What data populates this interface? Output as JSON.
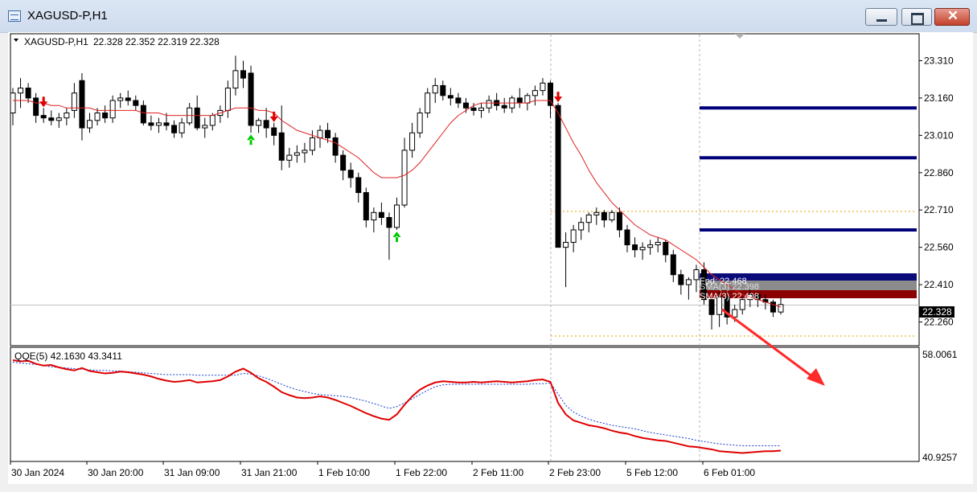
{
  "window": {
    "title": "XAGUSD-P,H1",
    "icons": [
      "chart-window-icon",
      "minimize-icon",
      "restore-icon",
      "close-icon"
    ]
  },
  "main_chart": {
    "symbol_label": "XAGUSD-P,H1",
    "ohlc": "22.328 22.352 22.319 22.328",
    "current_price": "22.328",
    "price_ticks": [
      "23.310",
      "23.160",
      "23.010",
      "22.860",
      "22.710",
      "22.560",
      "22.410",
      "22.260"
    ],
    "bar_labels": [
      "Fpd: 22.468",
      "SMA(3) 22.398",
      "SMA(3) 22.408"
    ],
    "colors": {
      "bull": "#ffffff",
      "bear": "#000000",
      "ma": "#e02020",
      "level_line": "#00007a",
      "arrow_up": "#00cc00",
      "arrow_down": "#e00000"
    }
  },
  "indicator": {
    "label": "QQE(5) 42.1630 43.3411",
    "max_label": "58.0061",
    "min_label": "40.9257"
  },
  "time_axis": {
    "labels": [
      "30 Jan 2024",
      "30 Jan 20:00",
      "31 Jan 09:00",
      "31 Jan 21:00",
      "1 Feb 10:00",
      "1 Feb 22:00",
      "2 Feb 11:00",
      "2 Feb 23:00",
      "5 Feb 12:00",
      "6 Feb 01:00"
    ]
  },
  "chart_data": {
    "type": "candlestick",
    "price_range": [
      22.21,
      23.36
    ],
    "candles": [
      [
        23.1,
        23.2,
        23.05,
        23.18
      ],
      [
        23.18,
        23.24,
        23.12,
        23.2
      ],
      [
        23.2,
        23.22,
        23.14,
        23.16
      ],
      [
        23.16,
        23.18,
        23.06,
        23.09
      ],
      [
        23.09,
        23.12,
        23.06,
        23.08
      ],
      [
        23.08,
        23.11,
        23.05,
        23.07
      ],
      [
        23.07,
        23.1,
        23.04,
        23.08
      ],
      [
        23.08,
        23.12,
        23.05,
        23.1
      ],
      [
        23.11,
        23.22,
        23.08,
        23.18
      ],
      [
        23.23,
        23.26,
        22.99,
        23.04
      ],
      [
        23.04,
        23.1,
        23.02,
        23.07
      ],
      [
        23.07,
        23.12,
        23.05,
        23.1
      ],
      [
        23.1,
        23.13,
        23.06,
        23.08
      ],
      [
        23.08,
        23.17,
        23.06,
        23.15
      ],
      [
        23.15,
        23.18,
        23.12,
        23.16
      ],
      [
        23.16,
        23.19,
        23.13,
        23.15
      ],
      [
        23.15,
        23.17,
        23.11,
        23.13
      ],
      [
        23.13,
        23.15,
        23.05,
        23.06
      ],
      [
        23.06,
        23.09,
        23.03,
        23.05
      ],
      [
        23.05,
        23.08,
        23.02,
        23.06
      ],
      [
        23.06,
        23.1,
        23.03,
        23.05
      ],
      [
        23.05,
        23.07,
        23.0,
        23.02
      ],
      [
        23.02,
        23.08,
        23.0,
        23.06
      ],
      [
        23.06,
        23.14,
        23.05,
        23.12
      ],
      [
        23.12,
        23.17,
        23.03,
        23.04
      ],
      [
        23.04,
        23.08,
        23.0,
        23.05
      ],
      [
        23.05,
        23.1,
        23.03,
        23.09
      ],
      [
        23.09,
        23.13,
        23.06,
        23.11
      ],
      [
        23.11,
        23.23,
        23.08,
        23.2
      ],
      [
        23.2,
        23.33,
        23.17,
        23.27
      ],
      [
        23.27,
        23.31,
        23.2,
        23.24
      ],
      [
        23.26,
        23.29,
        23.02,
        23.05
      ],
      [
        23.05,
        23.08,
        23.02,
        23.07
      ],
      [
        23.07,
        23.12,
        23.0,
        23.04
      ],
      [
        23.04,
        23.06,
        22.97,
        23.01
      ],
      [
        23.02,
        23.13,
        22.87,
        22.91
      ],
      [
        22.91,
        22.96,
        22.88,
        22.93
      ],
      [
        22.93,
        22.97,
        22.9,
        22.94
      ],
      [
        22.94,
        22.98,
        22.9,
        22.95
      ],
      [
        22.95,
        23.03,
        22.93,
        23.0
      ],
      [
        23.0,
        23.05,
        22.96,
        23.03
      ],
      [
        23.03,
        23.06,
        22.98,
        23.0
      ],
      [
        23.0,
        23.02,
        22.9,
        22.93
      ],
      [
        22.93,
        22.95,
        22.83,
        22.87
      ],
      [
        22.87,
        22.9,
        22.8,
        22.84
      ],
      [
        22.84,
        22.86,
        22.74,
        22.78
      ],
      [
        22.78,
        22.8,
        22.64,
        22.67
      ],
      [
        22.67,
        22.72,
        22.62,
        22.7
      ],
      [
        22.7,
        22.74,
        22.65,
        22.68
      ],
      [
        22.68,
        22.7,
        22.51,
        22.64
      ],
      [
        22.64,
        22.76,
        22.63,
        22.73
      ],
      [
        22.73,
        23.0,
        22.72,
        22.95
      ],
      [
        22.95,
        23.06,
        22.92,
        23.02
      ],
      [
        23.02,
        23.12,
        23.0,
        23.1
      ],
      [
        23.1,
        23.2,
        23.08,
        23.18
      ],
      [
        23.18,
        23.24,
        23.14,
        23.21
      ],
      [
        23.21,
        23.23,
        23.15,
        23.17
      ],
      [
        23.17,
        23.2,
        23.13,
        23.16
      ],
      [
        23.16,
        23.18,
        23.12,
        23.14
      ],
      [
        23.14,
        23.16,
        23.1,
        23.12
      ],
      [
        23.12,
        23.14,
        23.09,
        23.11
      ],
      [
        23.11,
        23.14,
        23.08,
        23.12
      ],
      [
        23.12,
        23.17,
        23.1,
        23.15
      ],
      [
        23.15,
        23.18,
        23.11,
        23.13
      ],
      [
        23.13,
        23.16,
        23.1,
        23.12
      ],
      [
        23.12,
        23.17,
        23.1,
        23.16
      ],
      [
        23.16,
        23.2,
        23.12,
        23.14
      ],
      [
        23.14,
        23.18,
        23.11,
        23.17
      ],
      [
        23.17,
        23.21,
        23.13,
        23.19
      ],
      [
        23.19,
        23.24,
        23.17,
        23.22
      ],
      [
        23.22,
        23.23,
        23.08,
        23.13
      ],
      [
        23.13,
        23.14,
        22.56,
        22.56
      ],
      [
        22.56,
        22.62,
        22.4,
        22.58
      ],
      [
        22.58,
        22.65,
        22.54,
        22.63
      ],
      [
        22.63,
        22.68,
        22.59,
        22.66
      ],
      [
        22.66,
        22.7,
        22.62,
        22.69
      ],
      [
        22.69,
        22.72,
        22.65,
        22.7
      ],
      [
        22.7,
        22.71,
        22.64,
        22.67
      ],
      [
        22.67,
        22.71,
        22.66,
        22.7
      ],
      [
        22.7,
        22.72,
        22.6,
        22.63
      ],
      [
        22.63,
        22.65,
        22.54,
        22.57
      ],
      [
        22.57,
        22.6,
        22.52,
        22.55
      ],
      [
        22.55,
        22.58,
        22.51,
        22.56
      ],
      [
        22.56,
        22.59,
        22.53,
        22.57
      ],
      [
        22.57,
        22.6,
        22.54,
        22.58
      ],
      [
        22.58,
        22.59,
        22.5,
        22.53
      ],
      [
        22.53,
        22.55,
        22.42,
        22.45
      ],
      [
        22.45,
        22.47,
        22.37,
        22.41
      ],
      [
        22.41,
        22.44,
        22.35,
        22.43
      ],
      [
        22.43,
        22.49,
        22.38,
        22.47
      ],
      [
        22.47,
        22.5,
        22.33,
        22.35
      ],
      [
        22.35,
        22.36,
        22.23,
        22.29
      ],
      [
        22.29,
        22.38,
        22.24,
        22.36
      ],
      [
        22.36,
        22.38,
        22.25,
        22.28
      ],
      [
        22.28,
        22.33,
        22.26,
        22.31
      ],
      [
        22.31,
        22.36,
        22.29,
        22.35
      ],
      [
        22.35,
        22.39,
        22.32,
        22.37
      ],
      [
        22.37,
        22.38,
        22.32,
        22.35
      ],
      [
        22.35,
        22.37,
        22.31,
        22.34
      ],
      [
        22.34,
        22.35,
        22.28,
        22.3
      ],
      [
        22.3,
        22.36,
        22.29,
        22.33
      ]
    ],
    "moving_average": [
      23.15,
      23.15,
      23.15,
      23.14,
      23.14,
      23.13,
      23.13,
      23.12,
      23.12,
      23.12,
      23.12,
      23.11,
      23.11,
      23.11,
      23.11,
      23.11,
      23.11,
      23.1,
      23.1,
      23.1,
      23.09,
      23.09,
      23.09,
      23.09,
      23.09,
      23.09,
      23.09,
      23.1,
      23.11,
      23.12,
      23.12,
      23.12,
      23.11,
      23.11,
      23.1,
      23.07,
      23.05,
      23.03,
      23.02,
      23.01,
      23.0,
      22.99,
      22.98,
      22.96,
      22.94,
      22.92,
      22.89,
      22.86,
      22.84,
      22.84,
      22.84,
      22.85,
      22.87,
      22.9,
      22.94,
      22.98,
      23.02,
      23.06,
      23.09,
      23.11,
      23.13,
      23.14,
      23.14,
      23.14,
      23.14,
      23.14,
      23.14,
      23.14,
      23.15,
      23.15,
      23.15,
      23.1,
      23.04,
      22.98,
      22.93,
      22.87,
      22.82,
      22.78,
      22.74,
      22.71,
      22.68,
      22.65,
      22.63,
      22.61,
      22.6,
      22.59,
      22.57,
      22.55,
      22.53,
      22.51,
      22.48,
      22.45,
      22.43,
      22.41,
      22.39,
      22.37,
      22.36,
      22.35,
      22.34,
      22.33,
      22.32
    ],
    "horizontal_levels": [
      23.12,
      22.92,
      22.63,
      22.468,
      22.42
    ],
    "signals": [
      {
        "index": 4,
        "dir": "down"
      },
      {
        "index": 31,
        "dir": "up"
      },
      {
        "index": 34,
        "dir": "down"
      },
      {
        "index": 50,
        "dir": "up"
      },
      {
        "index": 71,
        "dir": "down"
      }
    ],
    "qqe_range": [
      40.9257,
      58.0061
    ],
    "qqe_fast": [
      57.2,
      57.0,
      57.1,
      56.6,
      56.3,
      56.4,
      56.0,
      55.7,
      55.5,
      55.9,
      55.4,
      55.2,
      55.0,
      55.1,
      55.3,
      55.2,
      55.0,
      54.8,
      54.5,
      54.1,
      53.8,
      53.6,
      53.7,
      53.9,
      53.5,
      53.6,
      53.7,
      53.9,
      54.5,
      55.3,
      55.8,
      55.1,
      54.2,
      53.6,
      52.8,
      51.9,
      51.4,
      51.0,
      50.9,
      51.0,
      51.2,
      51.0,
      50.6,
      50.1,
      49.6,
      49.0,
      48.4,
      47.9,
      47.5,
      47.3,
      48.2,
      49.8,
      51.2,
      52.3,
      53.0,
      53.5,
      53.7,
      53.6,
      53.5,
      53.5,
      53.6,
      53.5,
      53.6,
      53.7,
      53.6,
      53.5,
      53.6,
      53.7,
      53.9,
      54.0,
      53.6,
      50.1,
      48.2,
      47.2,
      46.8,
      46.4,
      46.2,
      45.9,
      45.5,
      45.2,
      45.0,
      44.6,
      44.3,
      44.1,
      43.9,
      43.8,
      43.5,
      43.2,
      42.9,
      42.8,
      42.6,
      42.4,
      42.1,
      42.0,
      41.9,
      41.8,
      41.9,
      42.0,
      42.1,
      42.1,
      42.2
    ],
    "qqe_slow": [
      56.9,
      56.7,
      56.6,
      56.5,
      56.3,
      56.1,
      56.0,
      55.9,
      55.8,
      55.7,
      55.6,
      55.5,
      55.5,
      55.4,
      55.4,
      55.3,
      55.2,
      55.1,
      55.0,
      54.9,
      54.8,
      54.8,
      54.8,
      54.8,
      54.7,
      54.7,
      54.7,
      54.7,
      54.7,
      54.7,
      55.0,
      54.9,
      54.6,
      54.2,
      53.7,
      53.2,
      52.7,
      52.3,
      52.0,
      51.7,
      51.5,
      51.4,
      51.3,
      51.2,
      51.0,
      50.7,
      50.4,
      50.0,
      49.6,
      49.2,
      49.5,
      50.1,
      50.8,
      51.5,
      52.2,
      52.8,
      53.1,
      53.2,
      53.2,
      53.2,
      53.2,
      53.2,
      53.2,
      53.2,
      53.2,
      53.2,
      53.2,
      53.2,
      53.3,
      53.3,
      53.4,
      51.6,
      49.7,
      48.6,
      47.9,
      47.4,
      47.0,
      46.7,
      46.4,
      46.2,
      46.0,
      45.8,
      45.5,
      45.2,
      45.0,
      44.8,
      44.6,
      44.4,
      44.2,
      43.9,
      43.7,
      43.5,
      43.3,
      43.2,
      43.1,
      43.0,
      43.0,
      43.0,
      43.0,
      43.0,
      43.0
    ]
  }
}
